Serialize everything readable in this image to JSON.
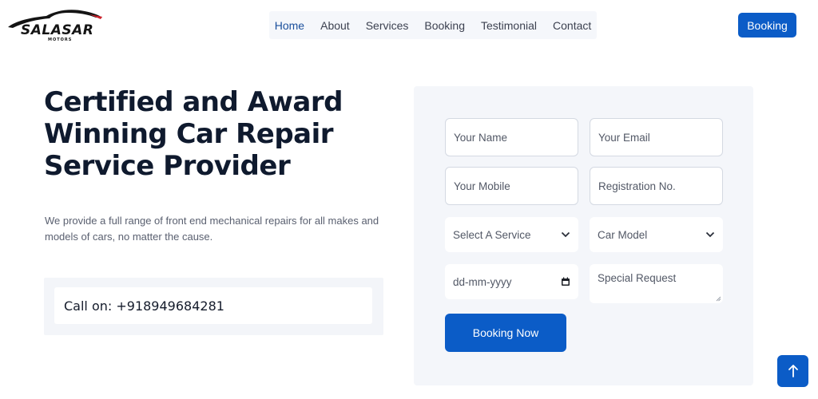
{
  "brand": {
    "name": "SALASAR",
    "sub": "MOTORS"
  },
  "nav": {
    "items": [
      {
        "label": "Home",
        "active": true
      },
      {
        "label": "About"
      },
      {
        "label": "Services"
      },
      {
        "label": "Booking"
      },
      {
        "label": "Testimonial"
      },
      {
        "label": "Contact"
      }
    ],
    "cta_label": "Booking"
  },
  "hero": {
    "title": "Certified and Award Winning Car Repair Service Provider",
    "description": "We provide a full range of front end mechanical repairs for all makes and models of cars, no matter the cause.",
    "call_text": "Call on: +918949684281"
  },
  "form": {
    "name_placeholder": "Your Name",
    "email_placeholder": "Your Email",
    "mobile_placeholder": "Your Mobile",
    "registration_placeholder": "Registration No.",
    "service_select": "Select A Service",
    "car_model_select": "Car Model",
    "date_placeholder": "dd-mm-yyyy",
    "special_request_placeholder": "Special Request",
    "submit_label": "Booking Now"
  },
  "icons": {
    "select_arrow": "chevron-down-icon",
    "date_picker": "calendar-icon",
    "scroll_top": "arrow-up-icon"
  },
  "colors": {
    "accent": "#0b5cc7",
    "nav_active": "#1a4f9c",
    "heading": "#0f1a2e"
  }
}
